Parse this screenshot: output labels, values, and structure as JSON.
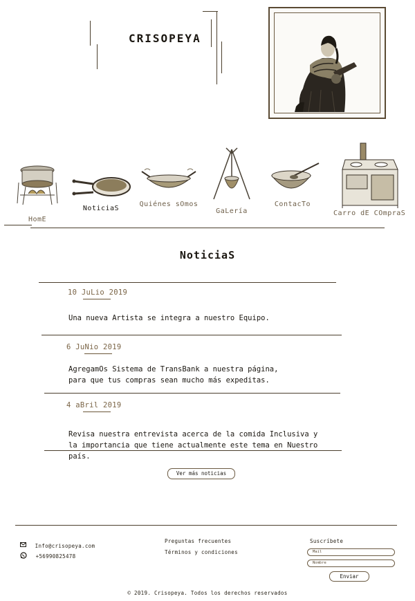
{
  "header": {
    "brand": "CRISOPEYA"
  },
  "nav": {
    "items": [
      {
        "label": "HomE",
        "icon": "pot-on-stove-icon",
        "active": false
      },
      {
        "label": "NoticiaS",
        "icon": "frying-pans-icon",
        "active": true
      },
      {
        "label": "Quiénes sOmos",
        "icon": "wok-icon",
        "active": false
      },
      {
        "label": "GaLería",
        "icon": "tripod-pot-icon",
        "active": false
      },
      {
        "label": "ContacTo",
        "icon": "bowl-spoon-icon",
        "active": false
      },
      {
        "label": "Carro dE COmpraS",
        "icon": "wood-stove-icon",
        "active": false
      }
    ]
  },
  "main": {
    "title": "NoticiaS",
    "news": [
      {
        "date": "10 JuLio 2019",
        "text": "Una nueva Artista se integra a nuestro Equipo."
      },
      {
        "date": "6 JuNio 2019",
        "text": "AgregamOs Sistema de TransBank a nuestra página, para que tus compras sean mucho más expeditas."
      },
      {
        "date": "4 aBril 2019",
        "text": "Revisa nuestra entrevista acerca de la comida Inclusiva y la importancia que tiene actualmente este tema en Nuestro país."
      }
    ],
    "more_label": "Ver más noticias"
  },
  "footer": {
    "email": "Info@crisopeya.com",
    "phone": "+56990825478",
    "links": [
      "Preguntas frecuentes",
      "Términos y condiciones"
    ],
    "subscribe_label": "Suscríbete",
    "mail_placeholder": "Mail",
    "name_placeholder": "Nombre",
    "send_label": "Enviar",
    "copyright": "© 2019. Crisopeya. Todos los derechos reservados"
  },
  "colors": {
    "ink": "#1a1610",
    "sepia": "#6b5a42",
    "accent_brown": "#7a6446"
  }
}
